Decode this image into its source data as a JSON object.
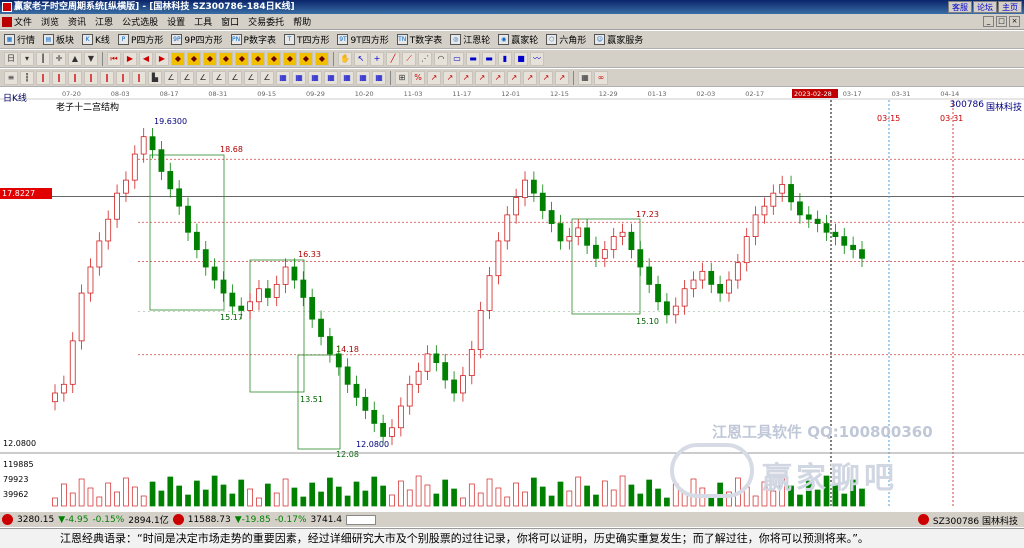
{
  "window": {
    "title": "赢家老子时空周期系统[纵横版] - [国林科技  SZ300786-184日K线]",
    "top_buttons": [
      "客服",
      "论坛",
      "主页"
    ],
    "win_controls": [
      "_",
      "□",
      "×"
    ]
  },
  "menu": [
    "文件",
    "浏览",
    "资讯",
    "江恩",
    "公式选股",
    "设置",
    "工具",
    "窗口",
    "交易委托",
    "帮助"
  ],
  "toolbar1": [
    {
      "icon": "table-icon",
      "label": "行情"
    },
    {
      "icon": "sector-icon",
      "label": "板块"
    },
    {
      "icon": "kline-icon",
      "label": "K线"
    },
    {
      "icon": "p-square-icon",
      "label": "P四方形"
    },
    {
      "icon": "9p-square-icon",
      "label": "9P四方形"
    },
    {
      "icon": "pn-table-icon",
      "label": "P数字表"
    },
    {
      "icon": "t-square-icon",
      "label": "T四方形"
    },
    {
      "icon": "9t-square-icon",
      "label": "9T四方形"
    },
    {
      "icon": "tn-table-icon",
      "label": "T数字表"
    },
    {
      "icon": "gann-wheel-icon",
      "label": "江恩轮"
    },
    {
      "icon": "winner-wheel-icon",
      "label": "赢家轮"
    },
    {
      "icon": "hexagon-icon",
      "label": "六角形"
    },
    {
      "icon": "service-icon",
      "label": "赢家服务"
    }
  ],
  "chart": {
    "period_label": "日K线",
    "structure_label": "老子十二宫结构",
    "code": "300786",
    "name": "国林科技",
    "current_price_label": "17.8227",
    "axis_low_label": "12.0800",
    "volume_ticks": [
      "119885",
      "79923",
      "39962"
    ],
    "x_dates": [
      "07-20",
      "08-03",
      "08-17",
      "08-31",
      "09-15",
      "09-29",
      "10-20",
      "11-03",
      "11-17",
      "12-01",
      "12-15",
      "12-29",
      "01-13",
      "02-03",
      "02-17",
      "2023-02-28",
      "03-17",
      "03-31",
      "04-14"
    ],
    "future_labels": [
      "03-15",
      "03-31"
    ],
    "price_levels": [
      "19.6300",
      "18.68",
      "16.33",
      "17.23",
      "14.18",
      "15.17",
      "15.10",
      "13.51",
      "12.08",
      "12.0800"
    ],
    "watermark_top": "江恩工具软件  QQ:100800360",
    "watermark_main": "赢家聊吧"
  },
  "statusbar": {
    "idx1_value": "3280.15",
    "idx1_change": "▼-4.95",
    "idx1_pct": "-0.15%",
    "idx1_amount": "2894.1亿",
    "idx2_value": "11588.73",
    "idx2_change": "▼-19.85",
    "idx2_pct": "-0.17%",
    "idx2_amount": "3741.4",
    "stock": "SZ300786 国林科技"
  },
  "quote": "江恩经典语录：“时间是决定市场走势的重要因素，经过详细研究大市及个别股票的过往记录，你将可以证明，历史确实重复发生；而了解过往，你将可以预测将来。”。"
}
